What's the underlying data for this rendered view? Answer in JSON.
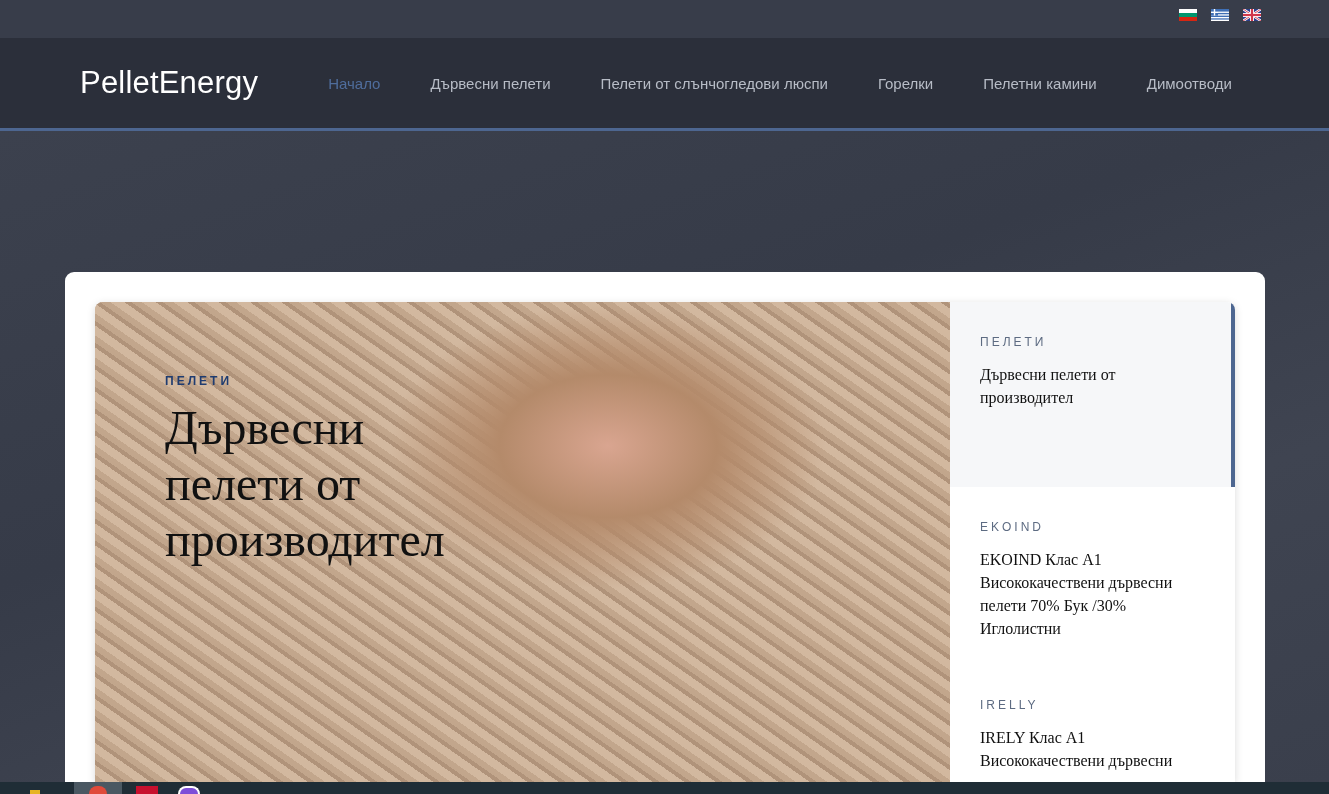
{
  "brand": "PelletEnergy",
  "nav": [
    {
      "label": "Начало",
      "selected": true
    },
    {
      "label": "Дървесни пелети",
      "selected": false
    },
    {
      "label": "Пелети от слънчогледови люспи",
      "selected": false
    },
    {
      "label": "Горелки",
      "selected": false
    },
    {
      "label": "Пелетни камини",
      "selected": false
    },
    {
      "label": "Димоотводи",
      "selected": false
    }
  ],
  "hero": {
    "category": "ПЕЛЕТИ",
    "title": "Дървесни пелети от производител"
  },
  "slides": [
    {
      "category": "ПЕЛЕТИ",
      "title": "Дървесни пелети от производител",
      "selected": true
    },
    {
      "category": "EKOIND",
      "title": "EKOIND Клас А1 Висококачествени дървесни пелети 70% Бук /30% Иглолистни",
      "selected": false
    },
    {
      "category": "IRELLY",
      "title": "IRELY Клас А1 Висококачествени дървесни",
      "selected": false
    }
  ]
}
